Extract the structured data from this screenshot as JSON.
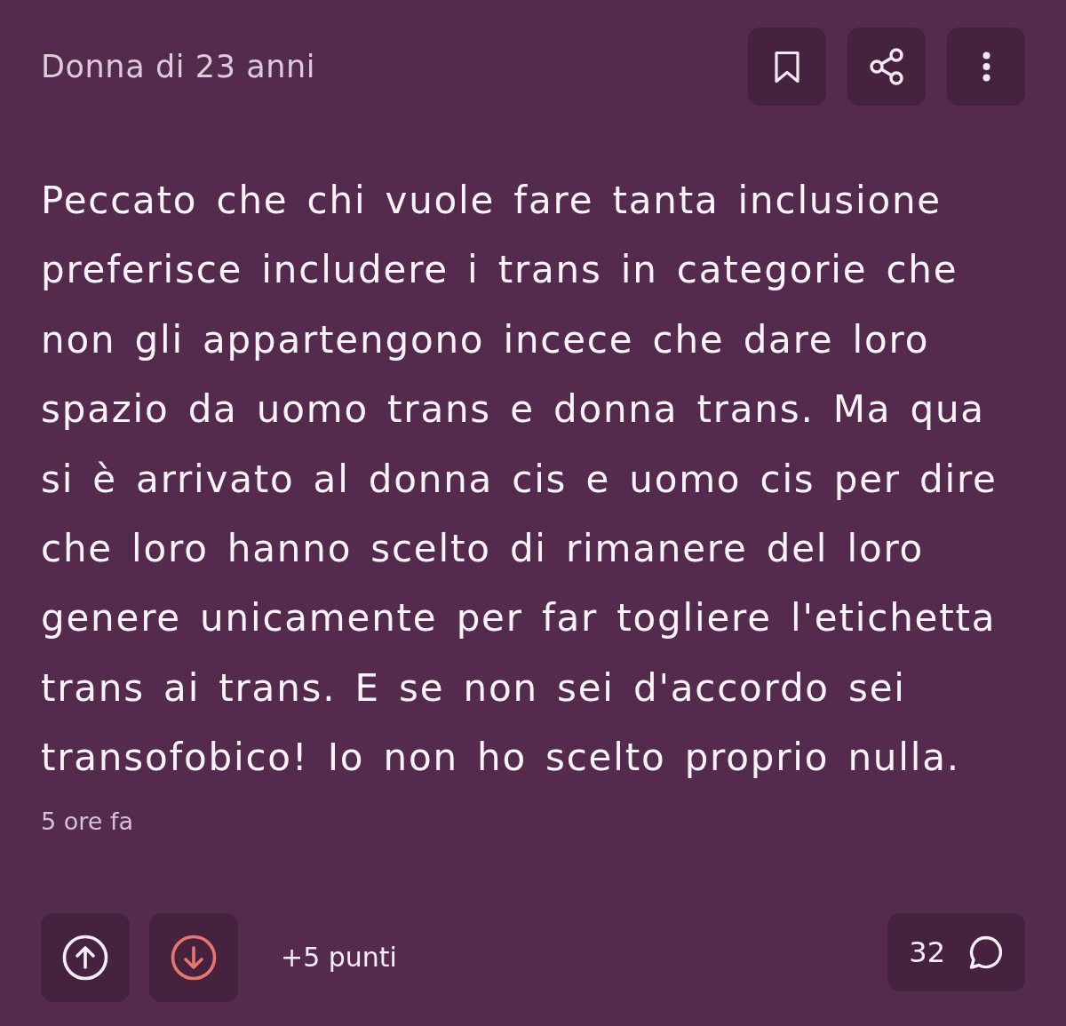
{
  "post": {
    "author": "Donna di 23 anni",
    "actions": [
      {
        "kind": "bookmark"
      },
      {
        "kind": "share"
      },
      {
        "kind": "more"
      }
    ],
    "body": "Peccato che chi vuole fare tanta inclusione preferisce includere i trans in categorie che non gli appartengono incece che dare loro spazio da uomo trans e donna trans. Ma qua si è arrivato al donna cis e uomo cis per dire che loro hanno scelto di rimanere del loro genere unicamente per far togliere l'etichetta trans ai trans. E se non sei d'accordo sei transofobico! Io non ho scelto proprio nulla.",
    "time": "5 ore fa"
  },
  "footer": {
    "votes": [
      {
        "kind": "up",
        "selected": false
      },
      {
        "kind": "down",
        "selected": true
      }
    ],
    "points": "+5 punti",
    "comments": "32"
  }
}
